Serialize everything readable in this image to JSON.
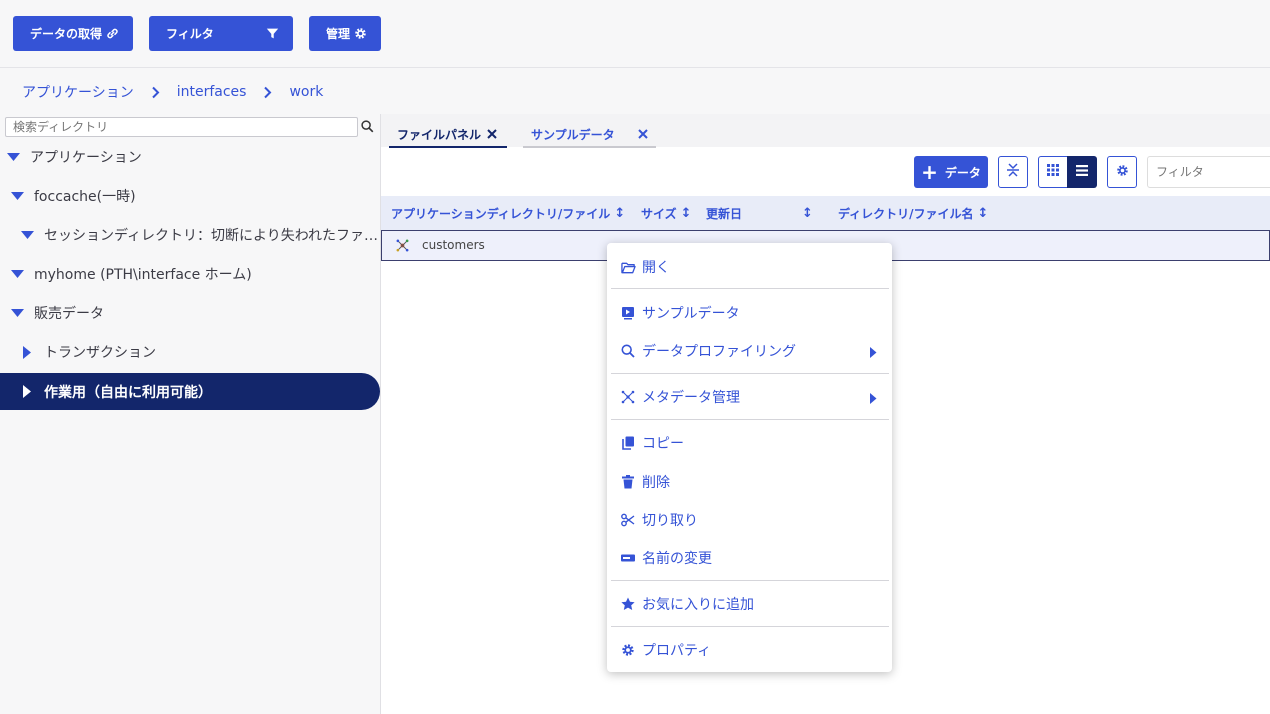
{
  "toolbar": {
    "get_data_label": "データの取得",
    "filter_label": "フィルタ",
    "manage_label": "管理"
  },
  "breadcrumb": {
    "items": [
      "アプリケーション",
      "interfaces",
      "work"
    ]
  },
  "left_panel": {
    "search_placeholder": "検索ディレクトリ",
    "tree": [
      {
        "label": "アプリケーション",
        "expanded": true
      },
      {
        "label": "foccache(一時)",
        "expanded": true
      },
      {
        "label": "セッションディレクトリ：切断により失われたファ…",
        "expanded": true
      },
      {
        "label": "myhome (PTH\\interface ホーム)",
        "expanded": true
      },
      {
        "label": "販売データ",
        "expanded": true
      },
      {
        "label": "トランザクション",
        "expanded": false
      },
      {
        "label": "作業用（自由に利用可能）",
        "expanded": false,
        "selected": true
      }
    ]
  },
  "tabs": [
    {
      "label": "ファイルパネル",
      "active": true
    },
    {
      "label": "サンプルデータ",
      "active": false
    }
  ],
  "actions": {
    "add_data_label": "データ",
    "filter_placeholder": "フィルタ"
  },
  "table": {
    "columns": [
      "アプリケーションディレクトリ/ファイル",
      "サイズ",
      "更新日",
      "ディレクトリ/ファイル名"
    ],
    "rows": [
      {
        "name": "customers",
        "size": "",
        "modified": "",
        "filename": ""
      }
    ]
  },
  "context_menu": {
    "items": [
      {
        "label": "開く",
        "icon": "folder-open-icon"
      },
      {
        "label": "サンプルデータ",
        "icon": "sample-icon"
      },
      {
        "label": "データプロファイリング",
        "icon": "search-icon",
        "submenu": true
      },
      {
        "label": "メタデータ管理",
        "icon": "metadata-icon",
        "submenu": true
      },
      {
        "label": "コピー",
        "icon": "copy-icon"
      },
      {
        "label": "削除",
        "icon": "trash-icon"
      },
      {
        "label": "切り取り",
        "icon": "scissors-icon"
      },
      {
        "label": "名前の変更",
        "icon": "rename-icon"
      },
      {
        "label": "お気に入りに追加",
        "icon": "star-icon"
      },
      {
        "label": "プロパティ",
        "icon": "gear-icon"
      }
    ]
  },
  "colors": {
    "accent": "#3553d6",
    "dark_accent": "#13266b",
    "row_highlight": "#eef0fb"
  }
}
